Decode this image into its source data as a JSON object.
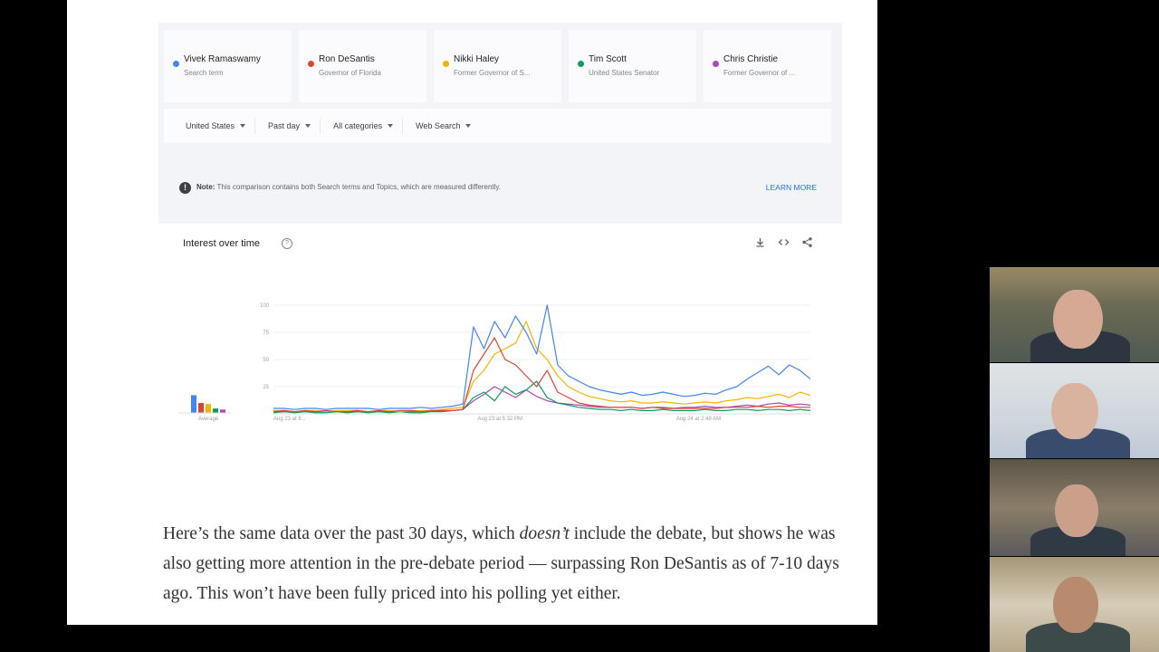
{
  "terms": [
    {
      "name": "Vivek Ramaswamy",
      "subtitle": "Search term",
      "color": "#4285f4"
    },
    {
      "name": "Ron DeSantis",
      "subtitle": "Governor of Florida",
      "color": "#db4437"
    },
    {
      "name": "Nikki Haley",
      "subtitle": "Former Governor of S...",
      "color": "#f4b400"
    },
    {
      "name": "Tim Scott",
      "subtitle": "United States Senator",
      "color": "#0f9d58"
    },
    {
      "name": "Chris Christie",
      "subtitle": "Former Governor of ...",
      "color": "#ab47bc"
    }
  ],
  "filters": [
    "United States",
    "Past day",
    "All categories",
    "Web Search"
  ],
  "note": {
    "label": "Note:",
    "text": "This comparison contains both Search terms and Topics, which are measured differently.",
    "learn_more": "LEARN MORE",
    "icon": "alert-icon"
  },
  "interest": {
    "title": "Interest over time",
    "help_icon": "help-circle-icon",
    "tool_icons": [
      "download-icon",
      "embed-code-icon",
      "share-icon"
    ]
  },
  "chart_data": {
    "type": "line",
    "title": "Interest over time",
    "y_ticks": [
      100,
      75,
      50,
      25
    ],
    "ylim": [
      0,
      100
    ],
    "x_tick_labels": [
      "Aug 23 at 8...",
      "Aug 23 at 5:32 PM",
      "Aug 24 at 2:48 AM"
    ],
    "grid": true,
    "average_label": "Average",
    "averages": [
      {
        "color": "#4285f4",
        "value": 16
      },
      {
        "color": "#db4437",
        "value": 9
      },
      {
        "color": "#f4b400",
        "value": 8
      },
      {
        "color": "#0f9d58",
        "value": 4
      },
      {
        "color": "#ab47bc",
        "value": 3
      }
    ],
    "series": [
      {
        "color": "#4285f4",
        "values": [
          5,
          5,
          4,
          5,
          5,
          4,
          5,
          5,
          5,
          5,
          4,
          5,
          5,
          5,
          6,
          5,
          6,
          7,
          9,
          80,
          60,
          85,
          70,
          90,
          75,
          55,
          100,
          45,
          35,
          30,
          25,
          22,
          20,
          18,
          20,
          17,
          18,
          20,
          18,
          16,
          17,
          19,
          18,
          22,
          25,
          32,
          38,
          44,
          36,
          45,
          40,
          32
        ]
      },
      {
        "color": "#db4437",
        "values": [
          2,
          3,
          2,
          3,
          2,
          3,
          2,
          2,
          3,
          2,
          3,
          2,
          3,
          3,
          2,
          3,
          3,
          3,
          4,
          40,
          55,
          70,
          50,
          45,
          35,
          25,
          40,
          20,
          15,
          10,
          8,
          7,
          6,
          6,
          6,
          5,
          6,
          5,
          5,
          5,
          5,
          5,
          5,
          6,
          6,
          6,
          7,
          6,
          7,
          7,
          6,
          6
        ]
      },
      {
        "color": "#f4b400",
        "values": [
          3,
          3,
          2,
          3,
          3,
          2,
          3,
          3,
          3,
          2,
          3,
          3,
          2,
          3,
          3,
          3,
          4,
          5,
          6,
          30,
          40,
          55,
          60,
          65,
          85,
          60,
          50,
          35,
          25,
          20,
          16,
          14,
          12,
          11,
          12,
          10,
          10,
          11,
          10,
          9,
          10,
          11,
          10,
          12,
          13,
          15,
          14,
          16,
          18,
          15,
          20,
          17
        ]
      },
      {
        "color": "#0f9d58",
        "values": [
          1,
          2,
          1,
          2,
          1,
          1,
          2,
          1,
          2,
          1,
          2,
          1,
          2,
          1,
          1,
          2,
          2,
          3,
          4,
          15,
          20,
          12,
          25,
          18,
          22,
          30,
          15,
          10,
          8,
          6,
          5,
          4,
          4,
          3,
          4,
          3,
          3,
          4,
          3,
          3,
          3,
          4,
          3,
          3,
          4,
          4,
          3,
          4,
          4,
          3,
          4,
          3
        ]
      },
      {
        "color": "#ab47bc",
        "values": [
          2,
          2,
          2,
          2,
          2,
          2,
          2,
          2,
          2,
          2,
          2,
          2,
          2,
          2,
          2,
          3,
          3,
          3,
          4,
          12,
          18,
          25,
          20,
          15,
          22,
          16,
          12,
          10,
          9,
          8,
          7,
          6,
          6,
          6,
          6,
          5,
          6,
          6,
          5,
          6,
          6,
          7,
          6,
          6,
          7,
          8,
          7,
          9,
          10,
          8,
          9,
          8
        ]
      }
    ]
  },
  "article": {
    "part1": "Here’s the same data over the past 30 days, which ",
    "emphasis": "doesn’t",
    "part2": " include the debate, but shows he was also getting more attention in the pre-debate period — surpassing Ron DeSantis as of 7-10 days ago. This won’t have been fully priced into his polling yet either."
  }
}
